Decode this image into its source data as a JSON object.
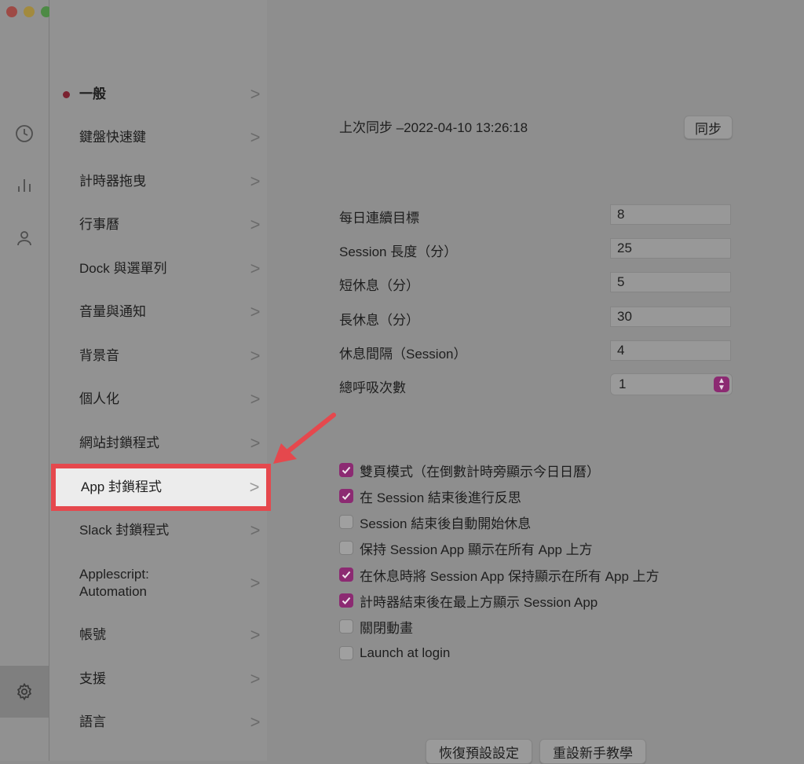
{
  "window": {
    "controls": [
      "close",
      "minimize",
      "zoom"
    ]
  },
  "rail": {
    "icons": [
      "clock-icon",
      "stats-icon",
      "user-icon",
      "gear-icon"
    ]
  },
  "menu": {
    "items": [
      {
        "label": "一般"
      },
      {
        "label": "鍵盤快速鍵"
      },
      {
        "label": "計時器拖曳"
      },
      {
        "label": "行事曆"
      },
      {
        "label": "Dock 與選單列"
      },
      {
        "label": "音量與通知"
      },
      {
        "label": "背景音"
      },
      {
        "label": "個人化"
      },
      {
        "label": "網站封鎖程式"
      },
      {
        "label": "App 封鎖程式"
      },
      {
        "label": "Slack 封鎖程式"
      },
      {
        "label": "Applescript:\nAutomation"
      },
      {
        "label": "帳號"
      },
      {
        "label": "支援"
      },
      {
        "label": "語言"
      }
    ],
    "chevron": ">"
  },
  "sync": {
    "text": "上次同步 –2022-04-10 13:26:18",
    "button": "同步"
  },
  "fields": [
    {
      "label": "每日連續目標",
      "value": "8"
    },
    {
      "label": "Session 長度（分）",
      "value": "25"
    },
    {
      "label": "短休息（分）",
      "value": "5"
    },
    {
      "label": "長休息（分）",
      "value": "30"
    },
    {
      "label": "休息間隔（Session）",
      "value": "4"
    }
  ],
  "breath": {
    "label": "總呼吸次數",
    "value": "1"
  },
  "checkboxes": [
    {
      "label": "雙頁模式（在倒數計時旁顯示今日日曆）",
      "checked": true
    },
    {
      "label": "在 Session 結束後進行反思",
      "checked": true
    },
    {
      "label": "Session 結束後自動開始休息",
      "checked": false
    },
    {
      "label": "保持 Session App 顯示在所有 App  上方",
      "checked": false
    },
    {
      "label": "在休息時將 Session App 保持顯示在所有 App  上方",
      "checked": true
    },
    {
      "label": "計時器結束後在最上方顯示 Session App",
      "checked": true
    },
    {
      "label": "關閉動畫",
      "checked": false
    },
    {
      "label": "Launch at login",
      "checked": false
    }
  ],
  "footer": {
    "reset_defaults": "恢復預設設定",
    "reset_tutorial": "重設新手教學"
  },
  "colors": {
    "accent": "#8c2a72",
    "highlight_border": "#e5484d",
    "bullet": "#7a2230"
  }
}
